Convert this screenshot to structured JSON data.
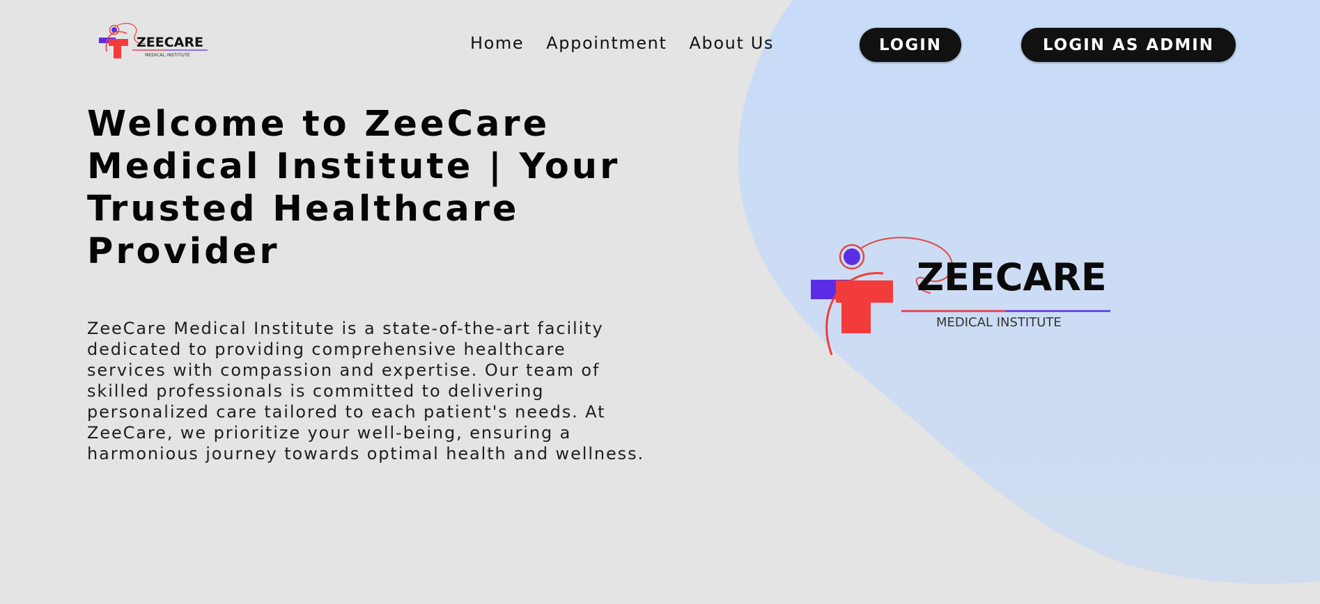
{
  "brand": {
    "name": "ZEECARE",
    "tagline": "MEDICAL INSTITUTE"
  },
  "nav": {
    "links": [
      {
        "label": "Home"
      },
      {
        "label": "Appointment"
      },
      {
        "label": "About Us"
      }
    ],
    "login_label": "LOGIN",
    "admin_label": "LOGIN AS ADMIN"
  },
  "hero": {
    "title": "Welcome to ZeeCare Medical Institute | Your Trusted Healthcare Provider",
    "description": "ZeeCare Medical Institute is a state-of-the-art facility dedicated to providing comprehensive healthcare services with compassion and expertise. Our team of skilled professionals is committed to delivering personalized care tailored to each patient's needs. At ZeeCare, we prioritize your well-being, ensuring a harmonious journey towards optimal health and wellness."
  },
  "colors": {
    "background": "#e4e4e4",
    "blob": "#c9dcf7",
    "button": "#111111",
    "logo_red": "#f23b3b",
    "logo_purple": "#5b2ee6"
  }
}
